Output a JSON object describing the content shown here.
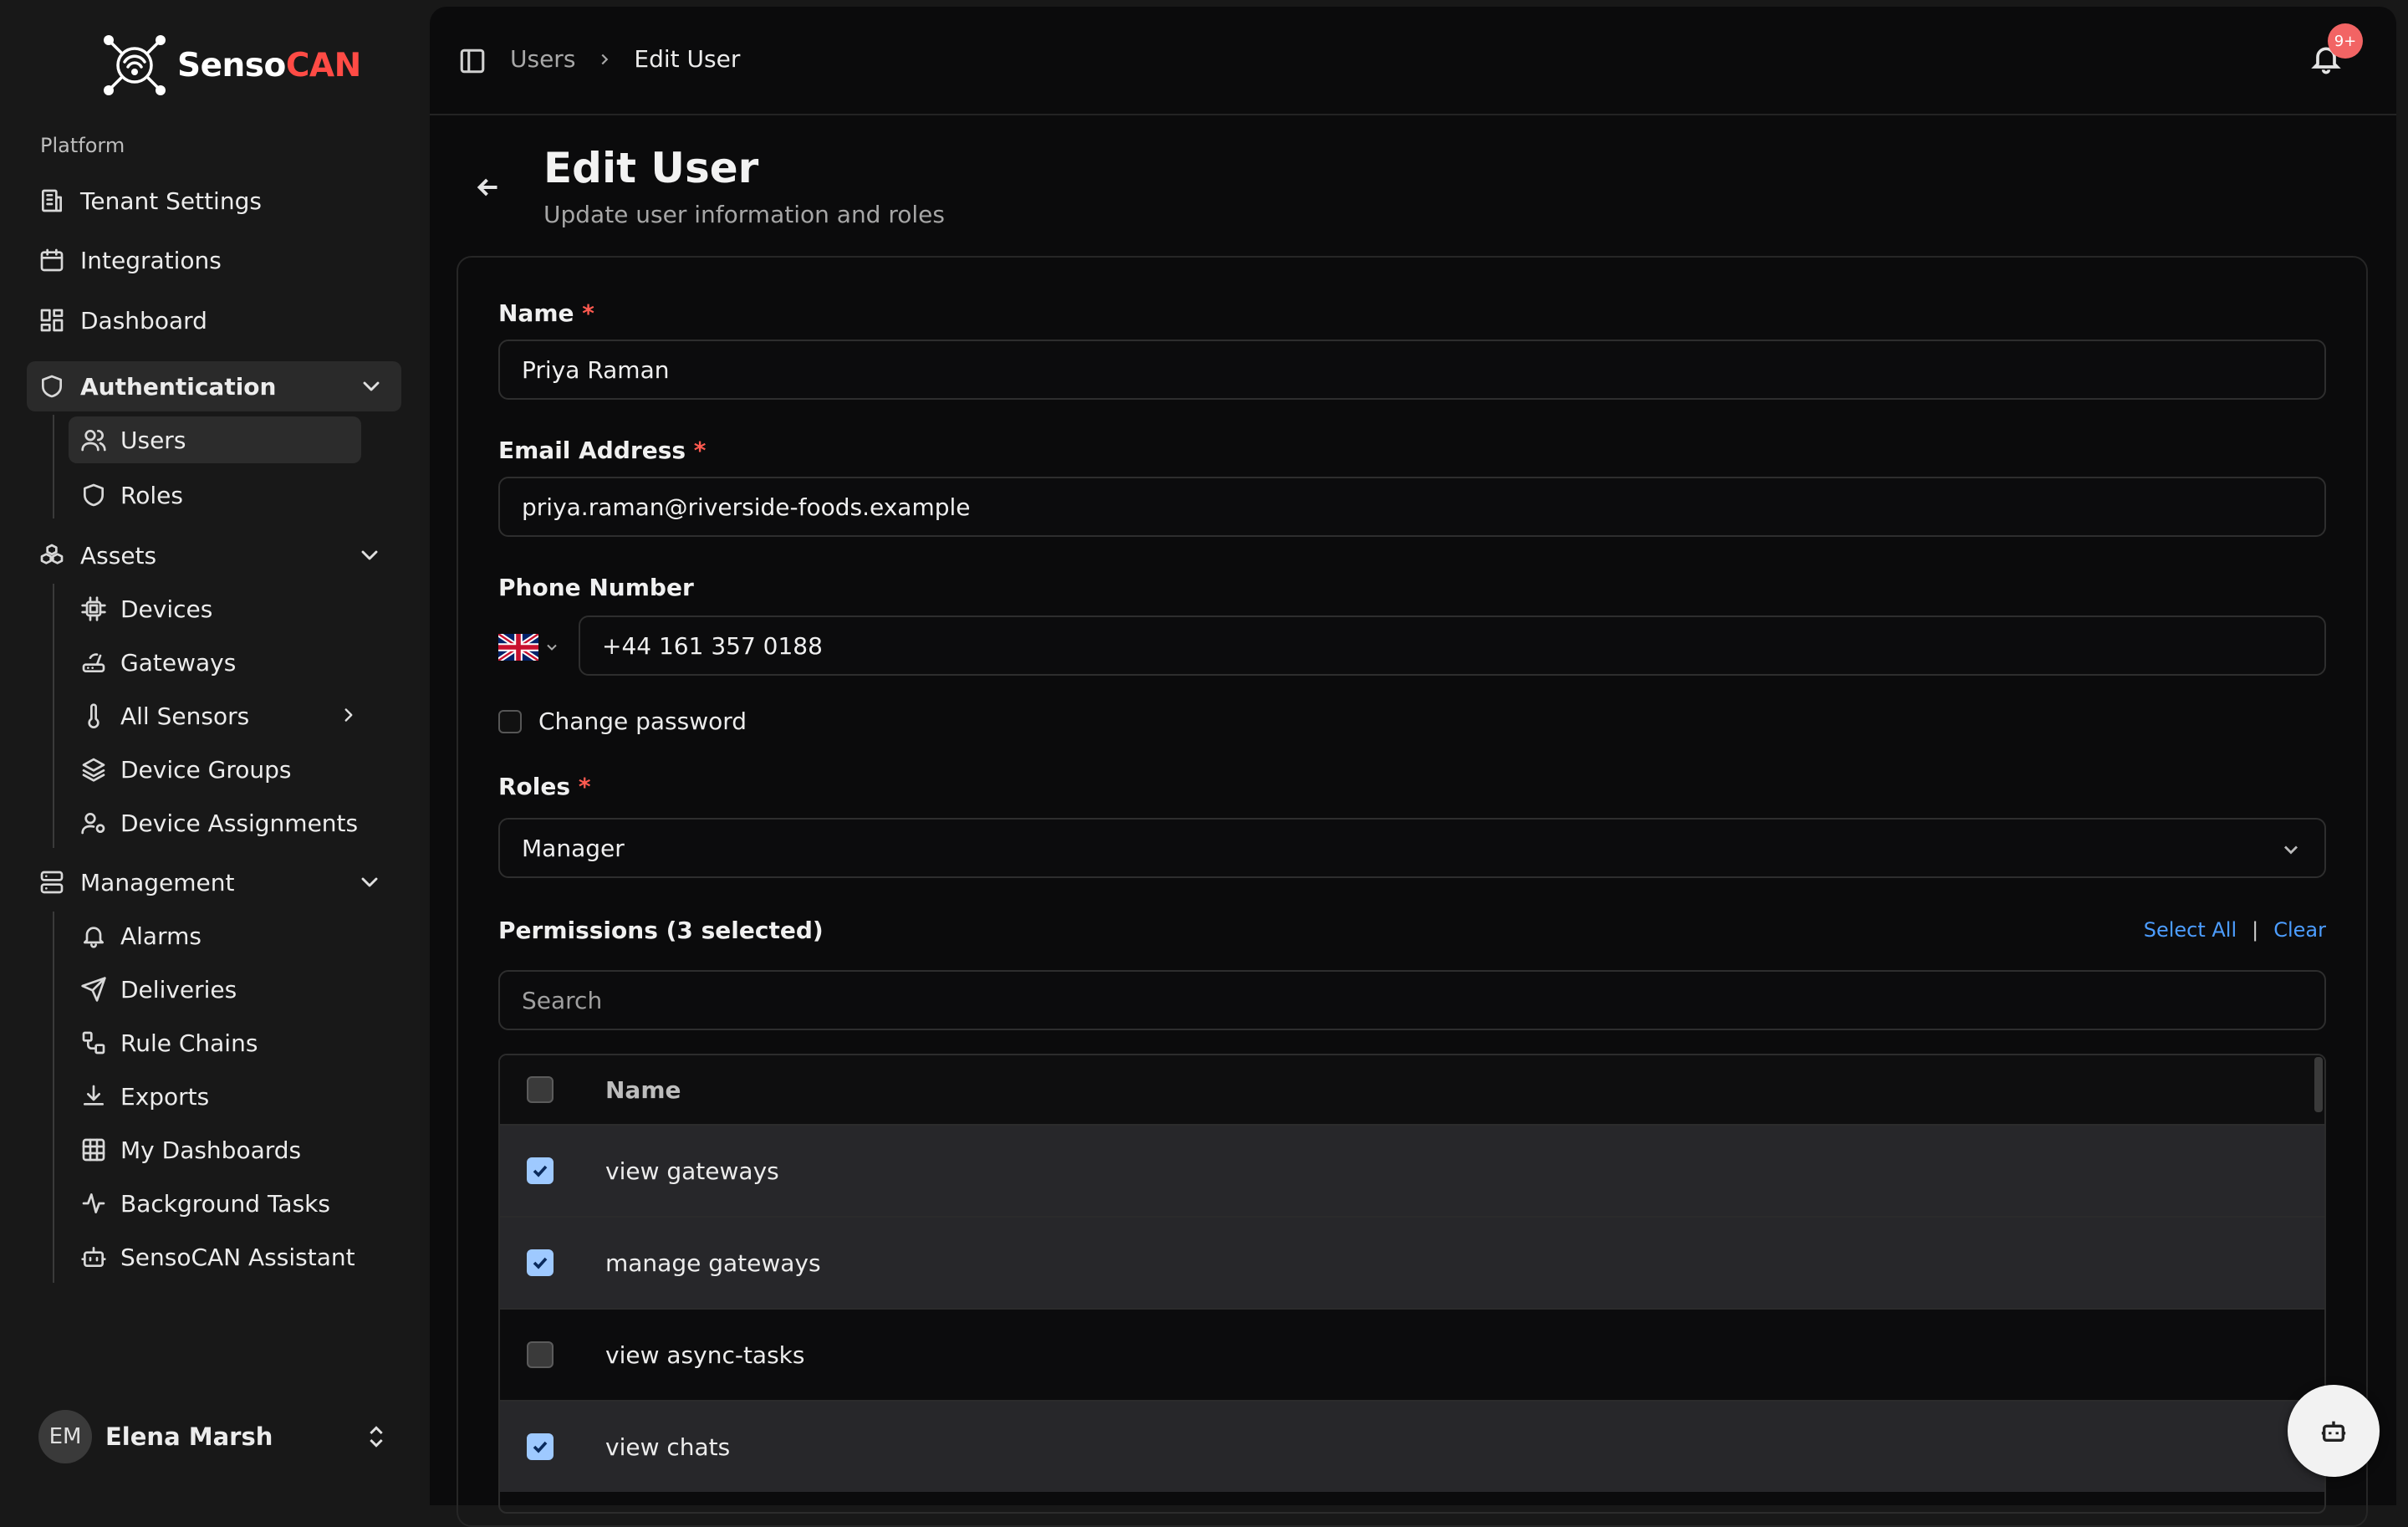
{
  "brand": {
    "name_part1": "Senso",
    "name_part2": "CAN",
    "accent": "#ff4b45"
  },
  "sidebar": {
    "section_label": "Platform",
    "top_items": [
      {
        "label": "Tenant Settings",
        "icon": "building-icon"
      },
      {
        "label": "Integrations",
        "icon": "calendar-icon"
      },
      {
        "label": "Dashboard",
        "icon": "layout-grid-icon"
      }
    ],
    "groups": {
      "authentication": {
        "label": "Authentication",
        "items": [
          {
            "label": "Users"
          },
          {
            "label": "Roles"
          }
        ]
      },
      "assets": {
        "label": "Assets",
        "items": [
          {
            "label": "Devices"
          },
          {
            "label": "Gateways"
          },
          {
            "label": "All Sensors"
          },
          {
            "label": "Device Groups"
          },
          {
            "label": "Device Assignments"
          }
        ]
      },
      "management": {
        "label": "Management",
        "items": [
          {
            "label": "Alarms"
          },
          {
            "label": "Deliveries"
          },
          {
            "label": "Rule Chains"
          },
          {
            "label": "Exports"
          },
          {
            "label": "My Dashboards"
          },
          {
            "label": "Background Tasks"
          },
          {
            "label": "SensoCAN Assistant"
          }
        ]
      }
    },
    "user": {
      "initials": "EM",
      "name": "Elena Marsh"
    }
  },
  "header": {
    "breadcrumb": {
      "parent": "Users",
      "current": "Edit User"
    },
    "notification_badge": "9+"
  },
  "page": {
    "title": "Edit User",
    "subtitle": "Update user information and roles"
  },
  "form": {
    "name": {
      "label": "Name",
      "required": "*",
      "value": "Priya Raman"
    },
    "email": {
      "label": "Email Address",
      "required": "*",
      "value": "priya.raman@riverside-foods.example"
    },
    "phone": {
      "label": "Phone Number",
      "value": "+44 161 357 0188",
      "country_flag": "uk-flag-icon"
    },
    "change_password": {
      "label": "Change password",
      "checked": false
    },
    "roles": {
      "label": "Roles",
      "required": "*",
      "value": "Manager"
    },
    "permissions": {
      "label": "Permissions (3 selected)",
      "select_all": "Select All",
      "separator": "|",
      "clear": "Clear",
      "search_placeholder": "Search",
      "column_name": "Name",
      "rows": [
        {
          "name": "view gateways",
          "checked": true
        },
        {
          "name": "manage gateways",
          "checked": true
        },
        {
          "name": "view async-tasks",
          "checked": false
        },
        {
          "name": "view chats",
          "checked": true
        }
      ]
    }
  }
}
